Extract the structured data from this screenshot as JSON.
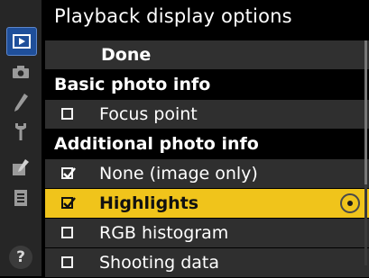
{
  "menu": {
    "title": "Playback display options",
    "help_symbol": "?",
    "tabs": [
      {
        "name": "playback",
        "icon": "playback-icon",
        "active": true
      },
      {
        "name": "shooting",
        "icon": "camera-icon",
        "active": false
      },
      {
        "name": "custom-settings",
        "icon": "pencil-icon",
        "active": false
      },
      {
        "name": "setup",
        "icon": "wrench-icon",
        "active": false
      },
      {
        "name": "retouch",
        "icon": "retouch-icon",
        "active": false
      },
      {
        "name": "my-menu",
        "icon": "list-icon",
        "active": false
      }
    ],
    "items": {
      "done": "Done",
      "basic_header": "Basic photo info",
      "focus_point": {
        "label": "Focus point",
        "checked": false
      },
      "additional_header": "Additional photo info",
      "none_image_only": {
        "label": "None (image only)",
        "checked": true
      },
      "highlights": {
        "label": "Highlights",
        "checked": true,
        "selected": true
      },
      "rgb_histogram": {
        "label": "RGB histogram",
        "checked": false
      },
      "shooting_data": {
        "label": "Shooting data",
        "checked": false
      }
    }
  },
  "colors": {
    "highlight": "#f0c41b",
    "active_tab": "#1f4f9a",
    "row_background": "#2f2f2f"
  }
}
